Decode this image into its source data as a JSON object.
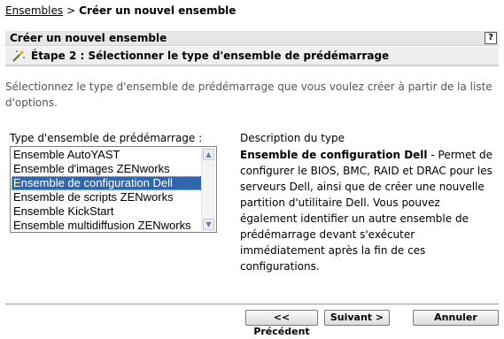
{
  "breadcrumb": {
    "parent": "Ensembles",
    "separator": ">",
    "current": "Créer un nouvel ensemble"
  },
  "panel": {
    "title": "Créer un nouvel ensemble",
    "help_label": "?",
    "step_icon": "magic-wand-icon",
    "step_title": "Étape 2 : Sélectionner le type d'ensemble de prédémarrage"
  },
  "intro": "Sélectionnez le type d'ensemble de prédémarrage que vous voulez créer à partir de la liste d'options.",
  "list": {
    "label": "Type d'ensemble de prédémarrage :",
    "items": [
      "Ensemble AutoYAST",
      "Ensemble d'images ZENworks",
      "Ensemble de configuration Dell",
      "Ensemble de scripts ZENworks",
      "Ensemble KickStart",
      "Ensemble multidiffusion ZENworks"
    ],
    "selected_index": 2,
    "selection_color": "#3166ad"
  },
  "description": {
    "label": "Description du type",
    "name": "Ensemble de configuration Dell",
    "text": " - Permet de configurer le BIOS, BMC, RAID et DRAC pour les serveurs Dell, ainsi que de créer une nouvelle partition d'utilitaire Dell. Vous pouvez également identifier un autre ensemble de prédémarrage devant s'exécuter immédiatement après la fin de ces configurations."
  },
  "buttons": {
    "previous": "<< Précédent",
    "next": "Suivant >",
    "cancel": "Annuler"
  },
  "colors": {
    "footer_line": "#d08b55",
    "header_bg": "#e6e6e6"
  }
}
